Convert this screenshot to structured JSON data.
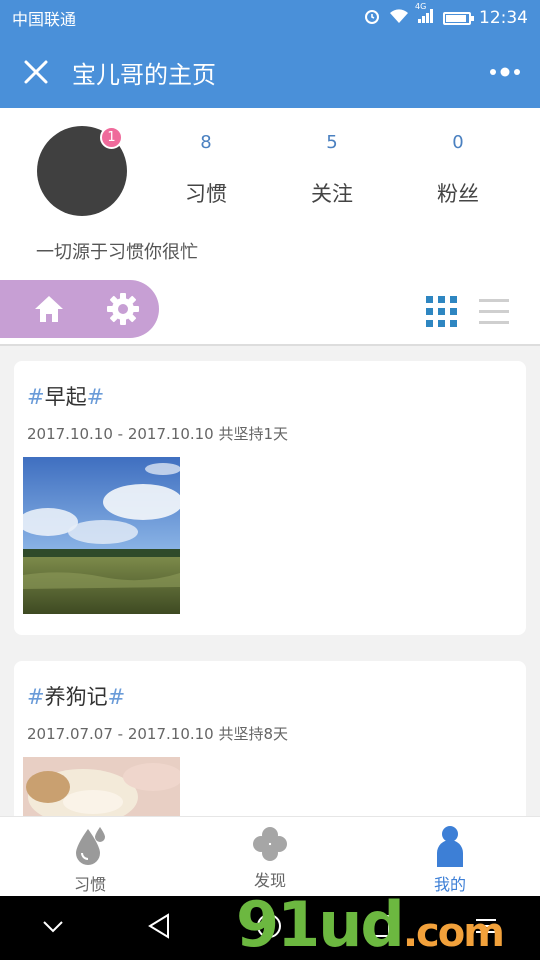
{
  "status_bar": {
    "carrier": "中国联通",
    "network": "4G",
    "time": "12:34",
    "battery_level": 0.9
  },
  "header": {
    "title": "宝儿哥的主页"
  },
  "profile": {
    "notification_count": "1",
    "stats": [
      {
        "value": "8",
        "label": "习惯"
      },
      {
        "value": "5",
        "label": "关注"
      },
      {
        "value": "0",
        "label": "粉丝"
      }
    ],
    "bio": "一切源于习惯你很忙"
  },
  "habits": [
    {
      "hash": "#",
      "name": "早起",
      "date_range": "2017.10.10 - 2017.10.10 共坚持1天"
    },
    {
      "hash": "#",
      "name": "养狗记",
      "date_range": "2017.07.07 - 2017.10.10 共坚持8天"
    }
  ],
  "tabs": [
    {
      "label": "习惯",
      "icon": "water-drop-icon"
    },
    {
      "label": "发现",
      "icon": "clover-icon"
    },
    {
      "label": "我的",
      "icon": "person-icon"
    }
  ],
  "watermark": {
    "main": "91ud",
    "suffix": ".com"
  },
  "colors": {
    "primary": "#4a90d9",
    "pill": "#c79fd4",
    "badge": "#ef6a9b",
    "active_tab": "#3d7fd6",
    "grid_icon": "#2e86c1"
  }
}
